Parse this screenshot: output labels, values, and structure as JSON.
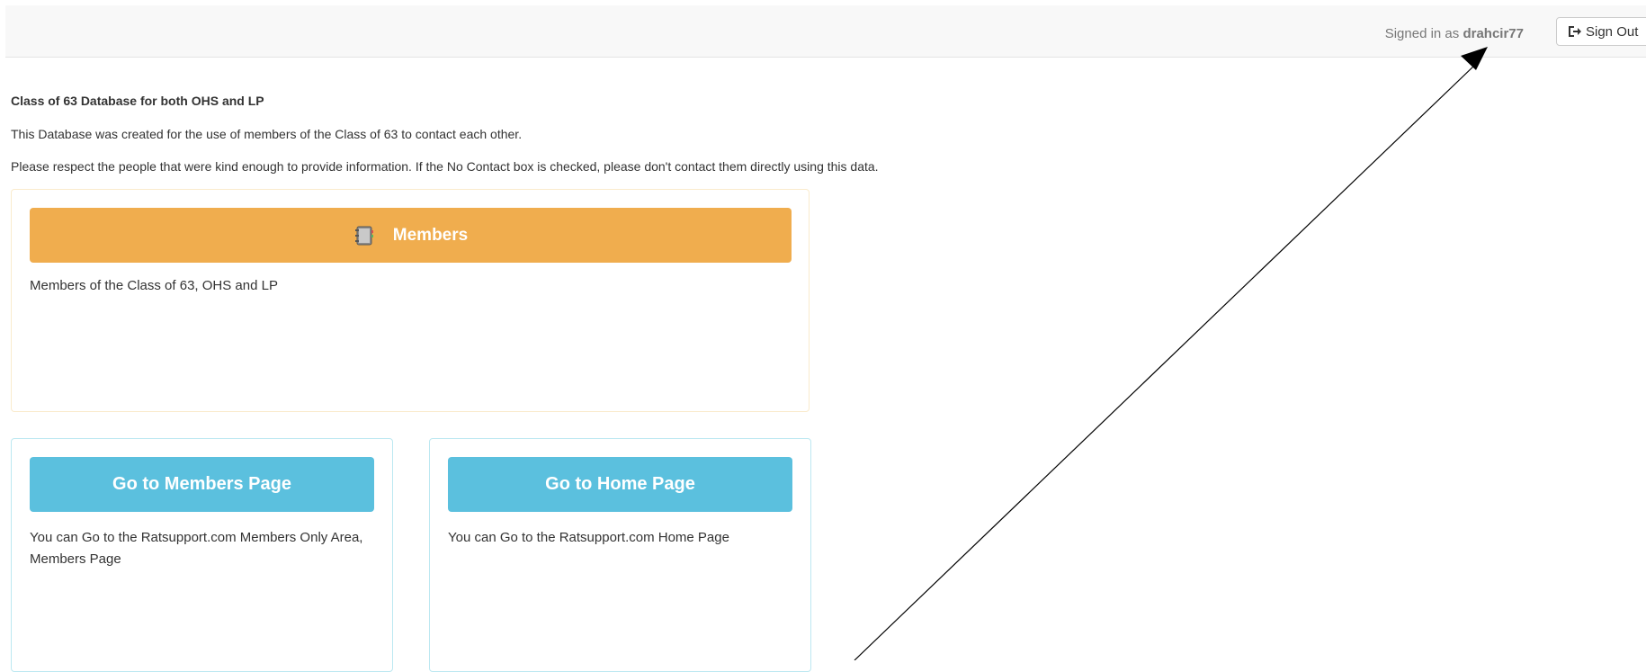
{
  "header": {
    "signed_in_prefix": "Signed in as",
    "username": "drahcir77",
    "sign_out_label": "Sign Out",
    "sign_out_icon": "sign-out-icon"
  },
  "intro": {
    "title": "Class of 63 Database for both OHS and LP",
    "line1": "This Database was created for the use of members of the Class of 63 to contact each other.",
    "line2": "Please respect the people that were kind enough to provide information. If the No Contact box is checked, please don't contact them directly using this data."
  },
  "members_panel": {
    "button_label": "Members",
    "button_icon": "address-book-icon",
    "description": "Members of the Class of 63, OHS and LP",
    "button_color": "#f0ad4e",
    "border_color": "#faebcc"
  },
  "link_panels": [
    {
      "button_label": "Go to Members Page",
      "description": "You can Go to the Ratsupport.com Members Only Area, Members Page"
    },
    {
      "button_label": "Go to Home Page",
      "description": "You can Go to the Ratsupport.com Home Page"
    }
  ],
  "colors": {
    "info_button": "#5bc0de",
    "info_border": "#bce8f1",
    "annotation_arrow": "#000000"
  }
}
